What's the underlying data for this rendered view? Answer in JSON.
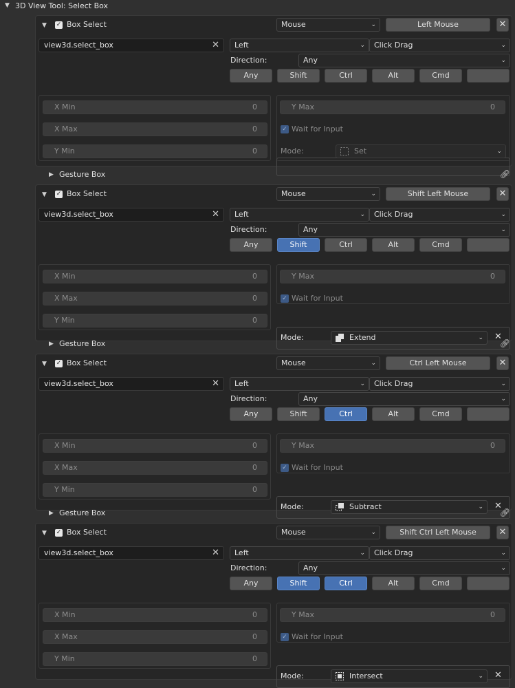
{
  "header": {
    "title": "3D View Tool: Select Box"
  },
  "items": [
    {
      "name": "Box Select",
      "device": "Mouse",
      "key": "Left Mouse",
      "operator": "view3d.select_box",
      "type": "Left",
      "value": "Click Drag",
      "direction_label": "Direction:",
      "direction": "Any",
      "mods": [
        {
          "label": "Any",
          "active": false
        },
        {
          "label": "Shift",
          "active": false
        },
        {
          "label": "Ctrl",
          "active": false
        },
        {
          "label": "Alt",
          "active": false
        },
        {
          "label": "Cmd",
          "active": false
        },
        {
          "label": "",
          "active": false
        }
      ],
      "xmin_label": "X Min",
      "xmin": "0",
      "ymax_label": "Y Max",
      "ymax": "0",
      "xmax_label": "X Max",
      "xmax": "0",
      "wait_label": "Wait for Input",
      "ymin_label": "Y Min",
      "ymin": "0",
      "mode_label": "Mode:",
      "mode": "Set",
      "mode_icon": "select-set-icon",
      "mode_enabled": false,
      "gesture_label": "Gesture Box"
    },
    {
      "name": "Box Select",
      "device": "Mouse",
      "key": "Shift Left Mouse",
      "operator": "view3d.select_box",
      "type": "Left",
      "value": "Click Drag",
      "direction_label": "Direction:",
      "direction": "Any",
      "mods": [
        {
          "label": "Any",
          "active": false
        },
        {
          "label": "Shift",
          "active": true
        },
        {
          "label": "Ctrl",
          "active": false
        },
        {
          "label": "Alt",
          "active": false
        },
        {
          "label": "Cmd",
          "active": false
        },
        {
          "label": "",
          "active": false
        }
      ],
      "xmin_label": "X Min",
      "xmin": "0",
      "ymax_label": "Y Max",
      "ymax": "0",
      "xmax_label": "X Max",
      "xmax": "0",
      "wait_label": "Wait for Input",
      "ymin_label": "Y Min",
      "ymin": "0",
      "mode_label": "Mode:",
      "mode": "Extend",
      "mode_icon": "select-extend-icon",
      "mode_enabled": true,
      "gesture_label": "Gesture Box"
    },
    {
      "name": "Box Select",
      "device": "Mouse",
      "key": "Ctrl Left Mouse",
      "operator": "view3d.select_box",
      "type": "Left",
      "value": "Click Drag",
      "direction_label": "Direction:",
      "direction": "Any",
      "mods": [
        {
          "label": "Any",
          "active": false
        },
        {
          "label": "Shift",
          "active": false
        },
        {
          "label": "Ctrl",
          "active": true
        },
        {
          "label": "Alt",
          "active": false
        },
        {
          "label": "Cmd",
          "active": false
        },
        {
          "label": "",
          "active": false
        }
      ],
      "xmin_label": "X Min",
      "xmin": "0",
      "ymax_label": "Y Max",
      "ymax": "0",
      "xmax_label": "X Max",
      "xmax": "0",
      "wait_label": "Wait for Input",
      "ymin_label": "Y Min",
      "ymin": "0",
      "mode_label": "Mode:",
      "mode": "Subtract",
      "mode_icon": "select-subtract-icon",
      "mode_enabled": true,
      "gesture_label": "Gesture Box"
    },
    {
      "name": "Box Select",
      "device": "Mouse",
      "key": "Shift Ctrl Left Mouse",
      "operator": "view3d.select_box",
      "type": "Left",
      "value": "Click Drag",
      "direction_label": "Direction:",
      "direction": "Any",
      "mods": [
        {
          "label": "Any",
          "active": false
        },
        {
          "label": "Shift",
          "active": true
        },
        {
          "label": "Ctrl",
          "active": true
        },
        {
          "label": "Alt",
          "active": false
        },
        {
          "label": "Cmd",
          "active": false
        },
        {
          "label": "",
          "active": false
        }
      ],
      "xmin_label": "X Min",
      "xmin": "0",
      "ymax_label": "Y Max",
      "ymax": "0",
      "xmax_label": "X Max",
      "xmax": "0",
      "wait_label": "Wait for Input",
      "ymin_label": "Y Min",
      "ymin": "0",
      "mode_label": "Mode:",
      "mode": "Intersect",
      "mode_icon": "select-intersect-icon",
      "mode_enabled": true,
      "gesture_label": ""
    }
  ],
  "colors": {
    "panel": "#262626",
    "active": "#4772b3",
    "background": "#303030"
  }
}
